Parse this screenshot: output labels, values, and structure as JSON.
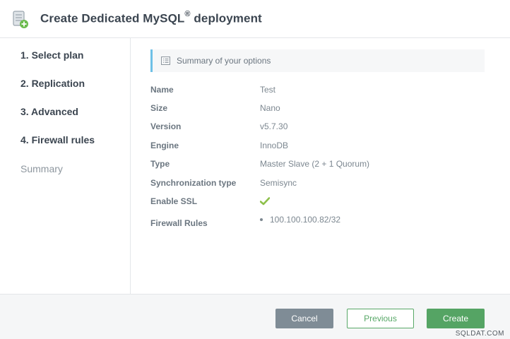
{
  "header": {
    "title_main": "Create Dedicated MySQL",
    "title_reg": "®",
    "title_tail": " deployment",
    "icon": "database-add-icon"
  },
  "sidebar": {
    "steps": [
      {
        "label": "1. Select plan"
      },
      {
        "label": "2. Replication"
      },
      {
        "label": "3. Advanced"
      },
      {
        "label": "4. Firewall rules"
      },
      {
        "label": "Summary"
      }
    ]
  },
  "summary": {
    "heading": "Summary of your options",
    "icon": "list-icon",
    "rows": [
      {
        "label": "Name",
        "value": "Test"
      },
      {
        "label": "Size",
        "value": "Nano"
      },
      {
        "label": "Version",
        "value": "v5.7.30"
      },
      {
        "label": "Engine",
        "value": "InnoDB"
      },
      {
        "label": "Type",
        "value": "Master Slave (2 + 1 Quorum)"
      },
      {
        "label": "Synchronization type",
        "value": "Semisync"
      }
    ],
    "ssl": {
      "label": "Enable SSL",
      "icon": "checkmark-icon",
      "color": "#8dc04a"
    },
    "firewall": {
      "label": "Firewall Rules",
      "items": [
        "100.100.100.82/32"
      ]
    }
  },
  "footer": {
    "cancel_label": "Cancel",
    "previous_label": "Previous",
    "create_label": "Create"
  },
  "watermark": "SQLDAT.COM",
  "colors": {
    "accent_blue": "#6ec0e6",
    "primary_green": "#55a464",
    "cancel_gray": "#7f8c96"
  }
}
